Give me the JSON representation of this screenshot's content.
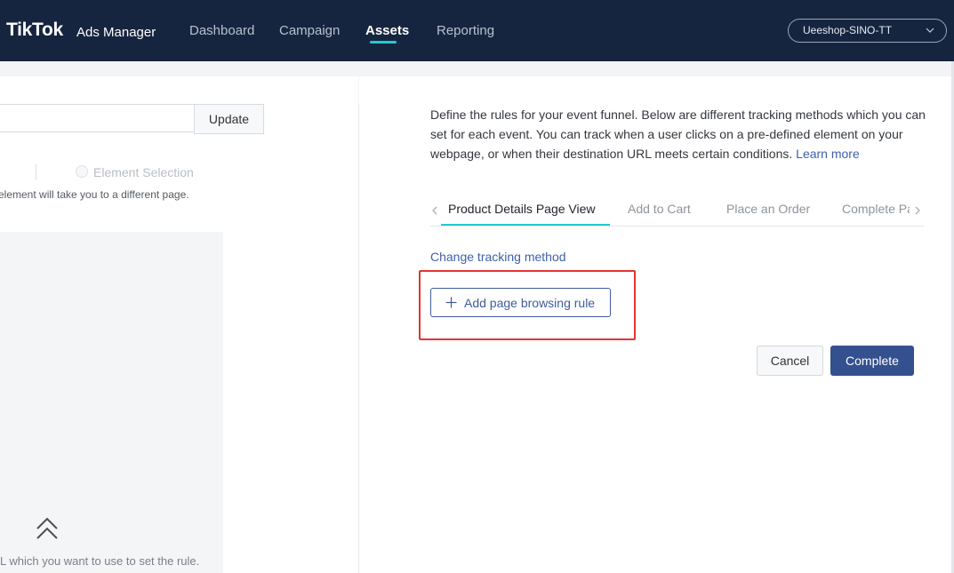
{
  "header": {
    "logo": "TikTok",
    "logo_suffix": "Ads Manager",
    "nav": [
      {
        "label": "Dashboard"
      },
      {
        "label": "Campaign"
      },
      {
        "label": "Assets",
        "active": true
      },
      {
        "label": "Reporting"
      }
    ],
    "account": "Ueeshop-SINO-TT"
  },
  "left_panel": {
    "url_input_value": "",
    "update_label": "Update",
    "option_element_selection": "Element Selection",
    "hint": "element will take you to a different page.",
    "bottom_text": "L which you want to use to set the rule."
  },
  "right_panel": {
    "description": "Define the rules for your event funnel. Below are different tracking methods which you can set for each event. You can track when a user clicks on a pre-defined element on your webpage, or when their destination URL meets certain conditions.",
    "learn_more": "Learn more",
    "tabs": [
      {
        "label": "Product Details Page View",
        "active": true
      },
      {
        "label": "Add to Cart"
      },
      {
        "label": "Place an Order"
      },
      {
        "label": "Complete Payment"
      }
    ],
    "change_tracking": "Change tracking method",
    "add_rule": "Add page browsing rule",
    "cancel": "Cancel",
    "complete": "Complete"
  },
  "colors": {
    "header_bg": "#16253f",
    "accent": "#25c9d0",
    "primary": "#34508e",
    "link": "#3f60a9",
    "highlight": "#e53232"
  }
}
